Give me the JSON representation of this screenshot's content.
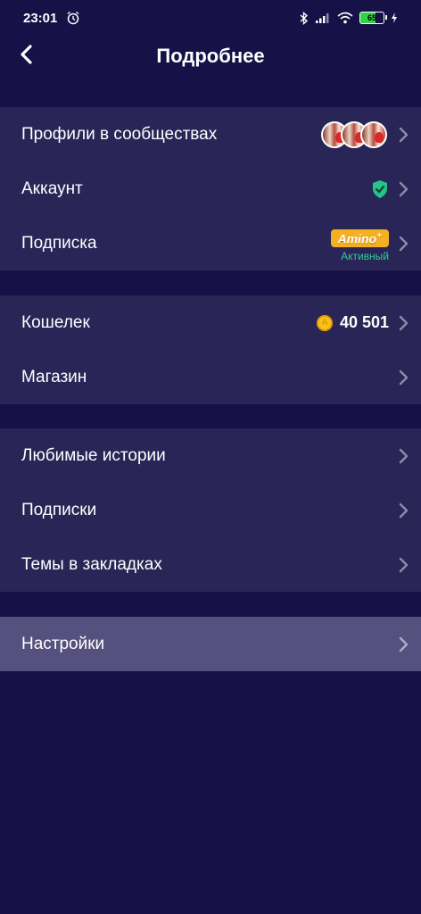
{
  "status": {
    "time": "23:01",
    "battery": "65"
  },
  "header": {
    "title": "Подробнее"
  },
  "groups": {
    "profile": {
      "communities_label": "Профили в сообществах",
      "account_label": "Аккаунт",
      "subscription_label": "Подписка",
      "subscription_badge": "Amino",
      "subscription_badge_plus": "+",
      "subscription_status": "Активный"
    },
    "wallet": {
      "wallet_label": "Кошелек",
      "wallet_value": "40 501",
      "store_label": "Магазин"
    },
    "content": {
      "favorites_label": "Любимые истории",
      "following_label": "Подписки",
      "bookmarks_label": "Темы в закладках"
    },
    "settings": {
      "settings_label": "Настройки"
    }
  },
  "colors": {
    "background": "#161146",
    "row_background": "#2a2557",
    "highlight": "#55507d",
    "accent_green": "#2ecc9a",
    "badge_gold": "#f5b021"
  },
  "icons": [
    "back-arrow-icon",
    "alarm-icon",
    "bluetooth-icon",
    "signal-icon",
    "wifi-icon",
    "battery-icon",
    "charging-icon",
    "shield-check-icon",
    "coin-icon",
    "chevron-right-icon"
  ]
}
